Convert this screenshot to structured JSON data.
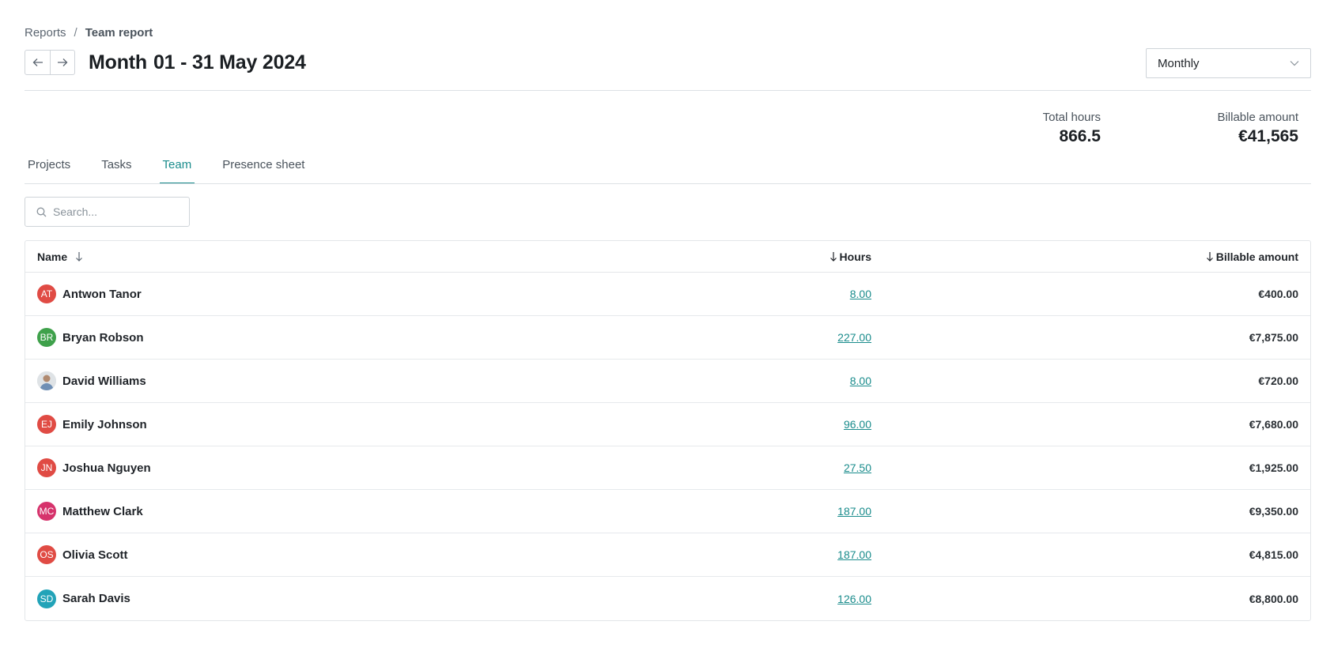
{
  "breadcrumb": {
    "root": "Reports",
    "separator": "/",
    "current": "Team report"
  },
  "header": {
    "period_label": "Month",
    "date_range": "01 - 31 May 2024"
  },
  "period_select": {
    "value": "Monthly"
  },
  "stats": {
    "total_hours_label": "Total hours",
    "total_hours_value": "866.5",
    "billable_label": "Billable amount",
    "billable_value": "€41,565"
  },
  "tabs": [
    {
      "label": "Projects",
      "active": false
    },
    {
      "label": "Tasks",
      "active": false
    },
    {
      "label": "Team",
      "active": true
    },
    {
      "label": "Presence sheet",
      "active": false
    }
  ],
  "search": {
    "placeholder": "Search..."
  },
  "table": {
    "columns": {
      "name": "Name",
      "hours": "Hours",
      "billable": "Billable amount"
    },
    "rows": [
      {
        "initials": "AT",
        "name": "Antwon Tanor",
        "hours": "8.00",
        "billable": "€400.00",
        "color": "#e04b44"
      },
      {
        "initials": "BR",
        "name": "Bryan Robson",
        "hours": "227.00",
        "billable": "€7,875.00",
        "color": "#3fa14b"
      },
      {
        "initials": "",
        "name": "David Williams",
        "hours": "8.00",
        "billable": "€720.00",
        "color": "#d9dde1",
        "photo": true
      },
      {
        "initials": "EJ",
        "name": "Emily Johnson",
        "hours": "96.00",
        "billable": "€7,680.00",
        "color": "#e04b44"
      },
      {
        "initials": "JN",
        "name": "Joshua Nguyen",
        "hours": "27.50",
        "billable": "€1,925.00",
        "color": "#e04b44"
      },
      {
        "initials": "MC",
        "name": "Matthew Clark",
        "hours": "187.00",
        "billable": "€9,350.00",
        "color": "#d6336c"
      },
      {
        "initials": "OS",
        "name": "Olivia Scott",
        "hours": "187.00",
        "billable": "€4,815.00",
        "color": "#e04b44"
      },
      {
        "initials": "SD",
        "name": "Sarah Davis",
        "hours": "126.00",
        "billable": "€8,800.00",
        "color": "#22a3b8"
      }
    ]
  }
}
